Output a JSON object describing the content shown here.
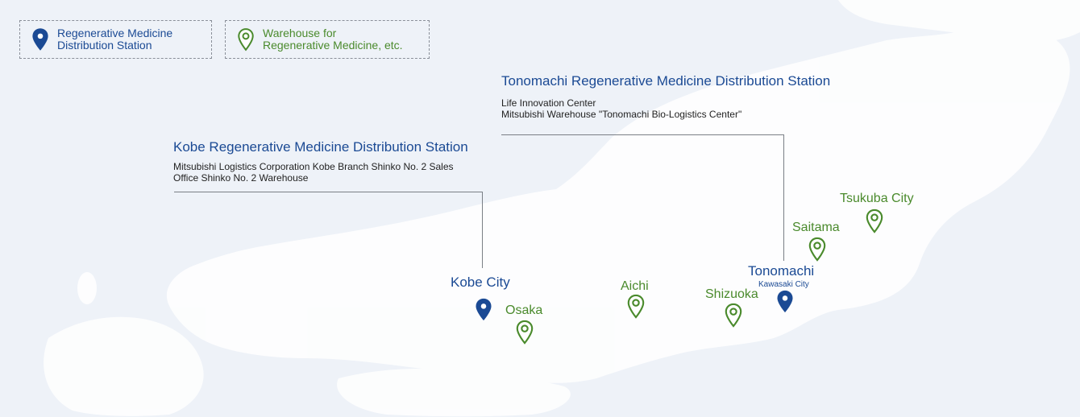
{
  "legend": {
    "station": {
      "label": "Regenerative Medicine\nDistribution Station",
      "icon": "navy-pin-icon",
      "color": "#1b4a94"
    },
    "warehouse": {
      "label": "Warehouse for\nRegenerative Medicine, etc.",
      "icon": "green-outline-pin-icon",
      "color": "#4a8a2c"
    }
  },
  "stations": {
    "tonomachi": {
      "title": "Tonomachi Regenerative Medicine Distribution Station",
      "lines": [
        "Life Innovation Center",
        "Mitsubishi Warehouse \"Tonomachi Bio-Logistics Center\""
      ]
    },
    "kobe": {
      "title": "Kobe Regenerative Medicine Distribution Station",
      "lines": [
        "Mitsubishi Logistics Corporation Kobe Branch Shinko No. 2 Sales",
        "Office Shinko No. 2 Warehouse"
      ]
    }
  },
  "cities": {
    "kobe": {
      "name": "Kobe City"
    },
    "tonomachi": {
      "name": "Tonomachi",
      "sub": "Kawasaki City"
    }
  },
  "warehouses": {
    "osaka": "Osaka",
    "aichi": "Aichi",
    "shizuoka": "Shizuoka",
    "saitama": "Saitama",
    "tsukuba": "Tsukuba City"
  },
  "colors": {
    "station": "#1b4a94",
    "warehouse": "#4a8a2c",
    "land": "#ffffff",
    "sea": "#eef2f8"
  }
}
